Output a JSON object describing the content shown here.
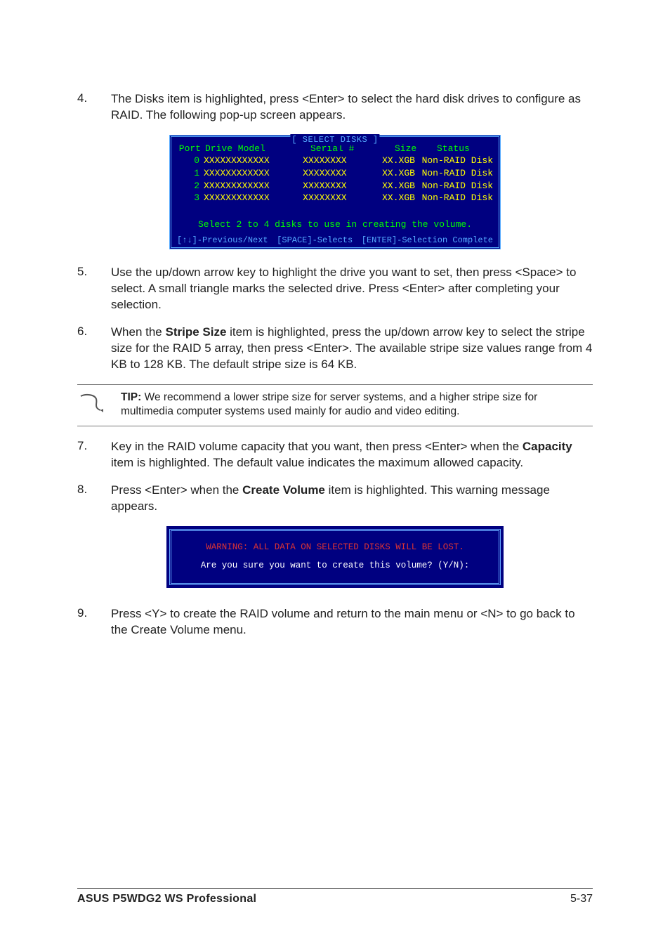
{
  "steps": {
    "s4": {
      "num": "4.",
      "text": "The Disks item is highlighted, press <Enter> to select the hard disk drives to configure as RAID. The following pop-up screen appears."
    },
    "s5": {
      "num": "5.",
      "text": "Use the up/down arrow key to highlight the drive you want to set, then press <Space> to select.  A small triangle marks the selected drive. Press <Enter> after completing your selection."
    },
    "s6": {
      "num": "6.",
      "pre": "When the ",
      "bold": "Stripe Size",
      "post": " item is highlighted, press the up/down arrow key to select the stripe size for the RAID 5 array, then press <Enter>. The available stripe size values range from 4 KB to 128 KB. The default stripe size is 64 KB."
    },
    "s7": {
      "num": "7.",
      "pre": "Key in the RAID volume capacity that you want, then press <Enter> when the ",
      "bold": "Capacity",
      "post": " item is highlighted. The default value indicates the maximum allowed capacity."
    },
    "s8": {
      "num": "8.",
      "pre": "Press <Enter> when the ",
      "bold": "Create Volume",
      "post": " item is highlighted. This warning message appears."
    },
    "s9": {
      "num": "9.",
      "text": "Press <Y> to create the RAID volume and return to the main menu or <N> to go back to the Create Volume menu."
    }
  },
  "selectDisks": {
    "title": "[ SELECT DISKS ]",
    "headers": {
      "port": "Port",
      "model": "Drive Model",
      "serial": "Serial #",
      "size": "Size",
      "status": "Status"
    },
    "rows": [
      {
        "port": "0",
        "model": "XXXXXXXXXXXX",
        "serial": "XXXXXXXX",
        "size": "XX.XGB",
        "status": "Non-RAID Disk"
      },
      {
        "port": "1",
        "model": "XXXXXXXXXXXX",
        "serial": "XXXXXXXX",
        "size": "XX.XGB",
        "status": "Non-RAID Disk"
      },
      {
        "port": "2",
        "model": "XXXXXXXXXXXX",
        "serial": "XXXXXXXX",
        "size": "XX.XGB",
        "status": "Non-RAID Disk"
      },
      {
        "port": "3",
        "model": "XXXXXXXXXXXX",
        "serial": "XXXXXXXX",
        "size": "XX.XGB",
        "status": "Non-RAID Disk"
      }
    ],
    "msg": "Select 2 to 4 disks to use in creating the volume.",
    "footer": {
      "a": "[↑↓]-Previous/Next",
      "b": "[SPACE]-Selects",
      "c": "[ENTER]-Selection Complete"
    }
  },
  "tip": {
    "label": "TIP: ",
    "text": "We recommend a lower stripe size for server systems, and a higher stripe size for multimedia computer systems used mainly for audio and video editing."
  },
  "warn": {
    "l1": "WARNING: ALL DATA ON SELECTED DISKS WILL BE LOST.",
    "l2": "Are you sure you want to create this volume? (Y/N):"
  },
  "footer": {
    "product": "ASUS P5WDG2 WS Professional",
    "page": "5-37"
  }
}
